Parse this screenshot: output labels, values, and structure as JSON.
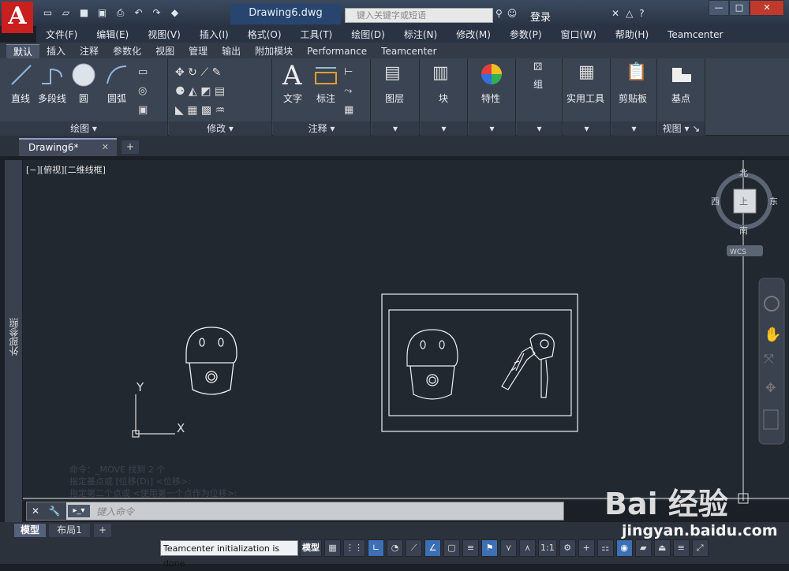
{
  "app": {
    "logo_letter": "A",
    "doc_title": "Drawing6.dwg"
  },
  "search": {
    "placeholder": "键入关键字或短语"
  },
  "user": {
    "login_label": "登录"
  },
  "menu": [
    "文件(F)",
    "编辑(E)",
    "视图(V)",
    "插入(I)",
    "格式(O)",
    "工具(T)",
    "绘图(D)",
    "标注(N)",
    "修改(M)",
    "参数(P)",
    "窗口(W)",
    "帮助(H)",
    "Teamcenter"
  ],
  "ribbon_tabs": [
    "默认",
    "插入",
    "注释",
    "参数化",
    "视图",
    "管理",
    "输出",
    "附加模块",
    "Performance",
    "Teamcenter"
  ],
  "ribbon": {
    "draw": {
      "line": "直线",
      "polyline": "多段线",
      "circle": "圆",
      "arc": "圆弧",
      "footer": "绘图"
    },
    "modify": {
      "footer": "修改"
    },
    "annotate": {
      "text": "文字",
      "dimension": "标注",
      "footer": "注释"
    },
    "layers": "图层",
    "block": "块",
    "properties": "特性",
    "group": "组",
    "utilities": "实用工具",
    "clipboard": "剪贴板",
    "view": {
      "base": "基点",
      "footer": "视图"
    }
  },
  "doc_tab": {
    "label": "Drawing6*"
  },
  "viewport": {
    "label": "[−][俯视][二维线框]"
  },
  "xref": {
    "label": "外部参照"
  },
  "viewcube": {
    "north": "北",
    "south": "南",
    "east": "东",
    "west": "西",
    "top": "上",
    "wcs": "WCS"
  },
  "ucs": {
    "x": "X",
    "y": "Y"
  },
  "command": {
    "history": [
      "命令：_MOVE  找到 2 个",
      "指定基点或 [位移(D)] <位移>:",
      "指定第二个点或 <使用第一个点作为位移>:"
    ],
    "placeholder": "键入命令"
  },
  "layouts": [
    "模型",
    "布局1"
  ],
  "status": {
    "message": "Teamcenter initialization is done",
    "model": "模型",
    "scale": "1:1"
  },
  "watermark": {
    "brand": "Bai  经验",
    "url": "jingyan.baidu.com"
  }
}
